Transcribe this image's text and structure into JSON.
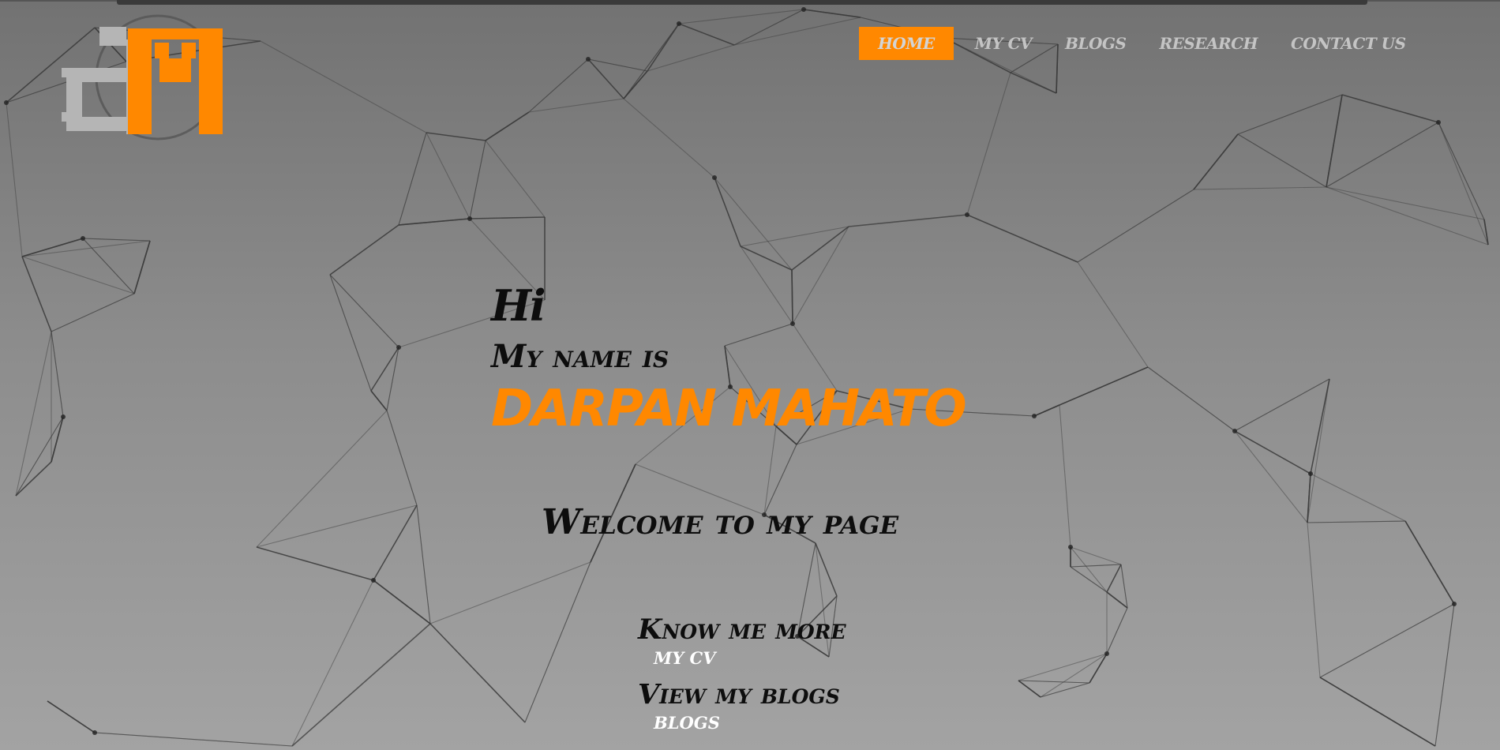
{
  "logo": {
    "left_letter": "d",
    "right_letter": "M",
    "left_color": "#b5b5b5",
    "right_color": "#ff8800"
  },
  "nav": {
    "items": [
      {
        "label": "HOME",
        "active": true
      },
      {
        "label": "MY CV",
        "active": false
      },
      {
        "label": "BLOGS",
        "active": false
      },
      {
        "label": "RESEARCH",
        "active": false
      },
      {
        "label": "CONTACT US",
        "active": false
      }
    ]
  },
  "hero": {
    "greeting": "Hi",
    "intro": "My name is",
    "name": "DARPAN MAHATO",
    "welcome": "Welcome to my page"
  },
  "links": {
    "know_more": "Know me more",
    "cv_link": "MY CV",
    "view_blogs": "View my blogs",
    "blogs_link": "BLOGS"
  },
  "colors": {
    "accent": "#ff8800",
    "text_dark": "#0d0d0d",
    "nav_text": "#c4c4c4",
    "network_lines": "#3a3a3a"
  }
}
